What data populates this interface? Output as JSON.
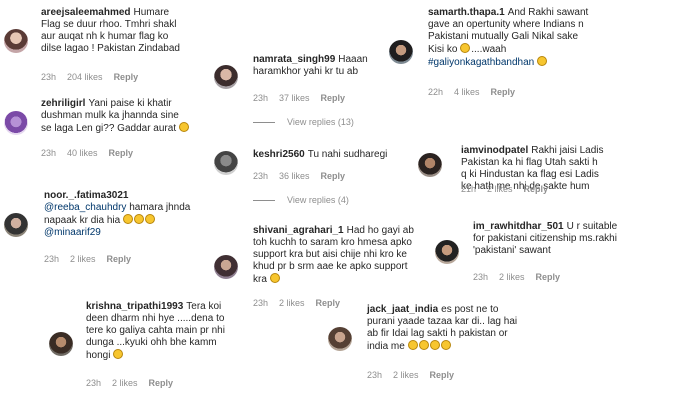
{
  "comments": [
    {
      "user": "areejsaleemahmed",
      "text": "Humare Flag se duur rhoo. Tmhri shakl aur auqat nh k humar flag ko dilse lagao ! Pakistan Zindabad",
      "time": "23h",
      "likes": "204 likes",
      "reply": "Reply"
    },
    {
      "user": "namrata_singh99",
      "text": "Haaan haramkhor yahi kr tu ab",
      "time": "23h",
      "likes": "37 likes",
      "reply": "Reply",
      "view_replies": "View replies (13)"
    },
    {
      "user": "samarth.thapa.1",
      "text": "And Rakhi sawant gave an opertunity where Indians n Pakistani mutually Gali Nikal sake Kisi ko",
      "text2": "....waah",
      "hashtag": "#galiyonkagathbandhan",
      "time": "22h",
      "likes": "4 likes",
      "reply": "Reply"
    },
    {
      "user": "zehriligirl",
      "text": "Yani paise ki khatir dushman mulk ka jhannda sine se laga Len gi?? Gaddar aurat",
      "time": "23h",
      "likes": "40 likes",
      "reply": "Reply"
    },
    {
      "user": "keshri2560",
      "text": "Tu nahi sudharegi",
      "time": "23h",
      "likes": "36 likes",
      "reply": "Reply",
      "view_replies": "View replies (4)"
    },
    {
      "user": "iamvinodpatel",
      "text": "Rakhi jaisi Ladis Pakistan ka hi flag Utah sakti h q ki Hindustan ka flag esi Ladis ke hath me nhi de sakte hum",
      "time": "21h",
      "likes": "2 likes",
      "reply": "Reply"
    },
    {
      "user": "noor._.fatima3021",
      "mention1": "@reeba_chauhdry",
      "text": "hamara jhnda napaak kr dia hia",
      "mention2": "@minaarif29",
      "time": "23h",
      "likes": "2 likes",
      "reply": "Reply"
    },
    {
      "user": "shivani_agrahari_1",
      "text": "Had ho gayi ab toh kuchh to saram kro hmesa apko support kra but aisi chije nhi kro ke khud pr b srm aae ke apko support kra",
      "time": "23h",
      "likes": "2 likes",
      "reply": "Reply"
    },
    {
      "user": "im_rawhitdhar_501",
      "text": "U r suitable for pakistani citizenship ms.rakhi 'pakistani' sawant",
      "time": "23h",
      "likes": "2 likes",
      "reply": "Reply"
    },
    {
      "user": "krishna_tripathi1993",
      "text": "Tera koi deen dharm nhi hye .....dena to tere ko galiya cahta main pr nhi dunga ...kyuki ohh bhe kamm hongi",
      "time": "23h",
      "likes": "2 likes",
      "reply": "Reply"
    },
    {
      "user": "jack_jaat_india",
      "text": "es post ne to purani yaade tazaa kar di.. lag hai ab fir Idai lag sakti h pakistan or india me",
      "time": "23h",
      "likes": "2 likes",
      "reply": "Reply"
    }
  ],
  "colors": {
    "text": "#262626",
    "meta": "#8e8e8e",
    "mention": "#00376b"
  }
}
